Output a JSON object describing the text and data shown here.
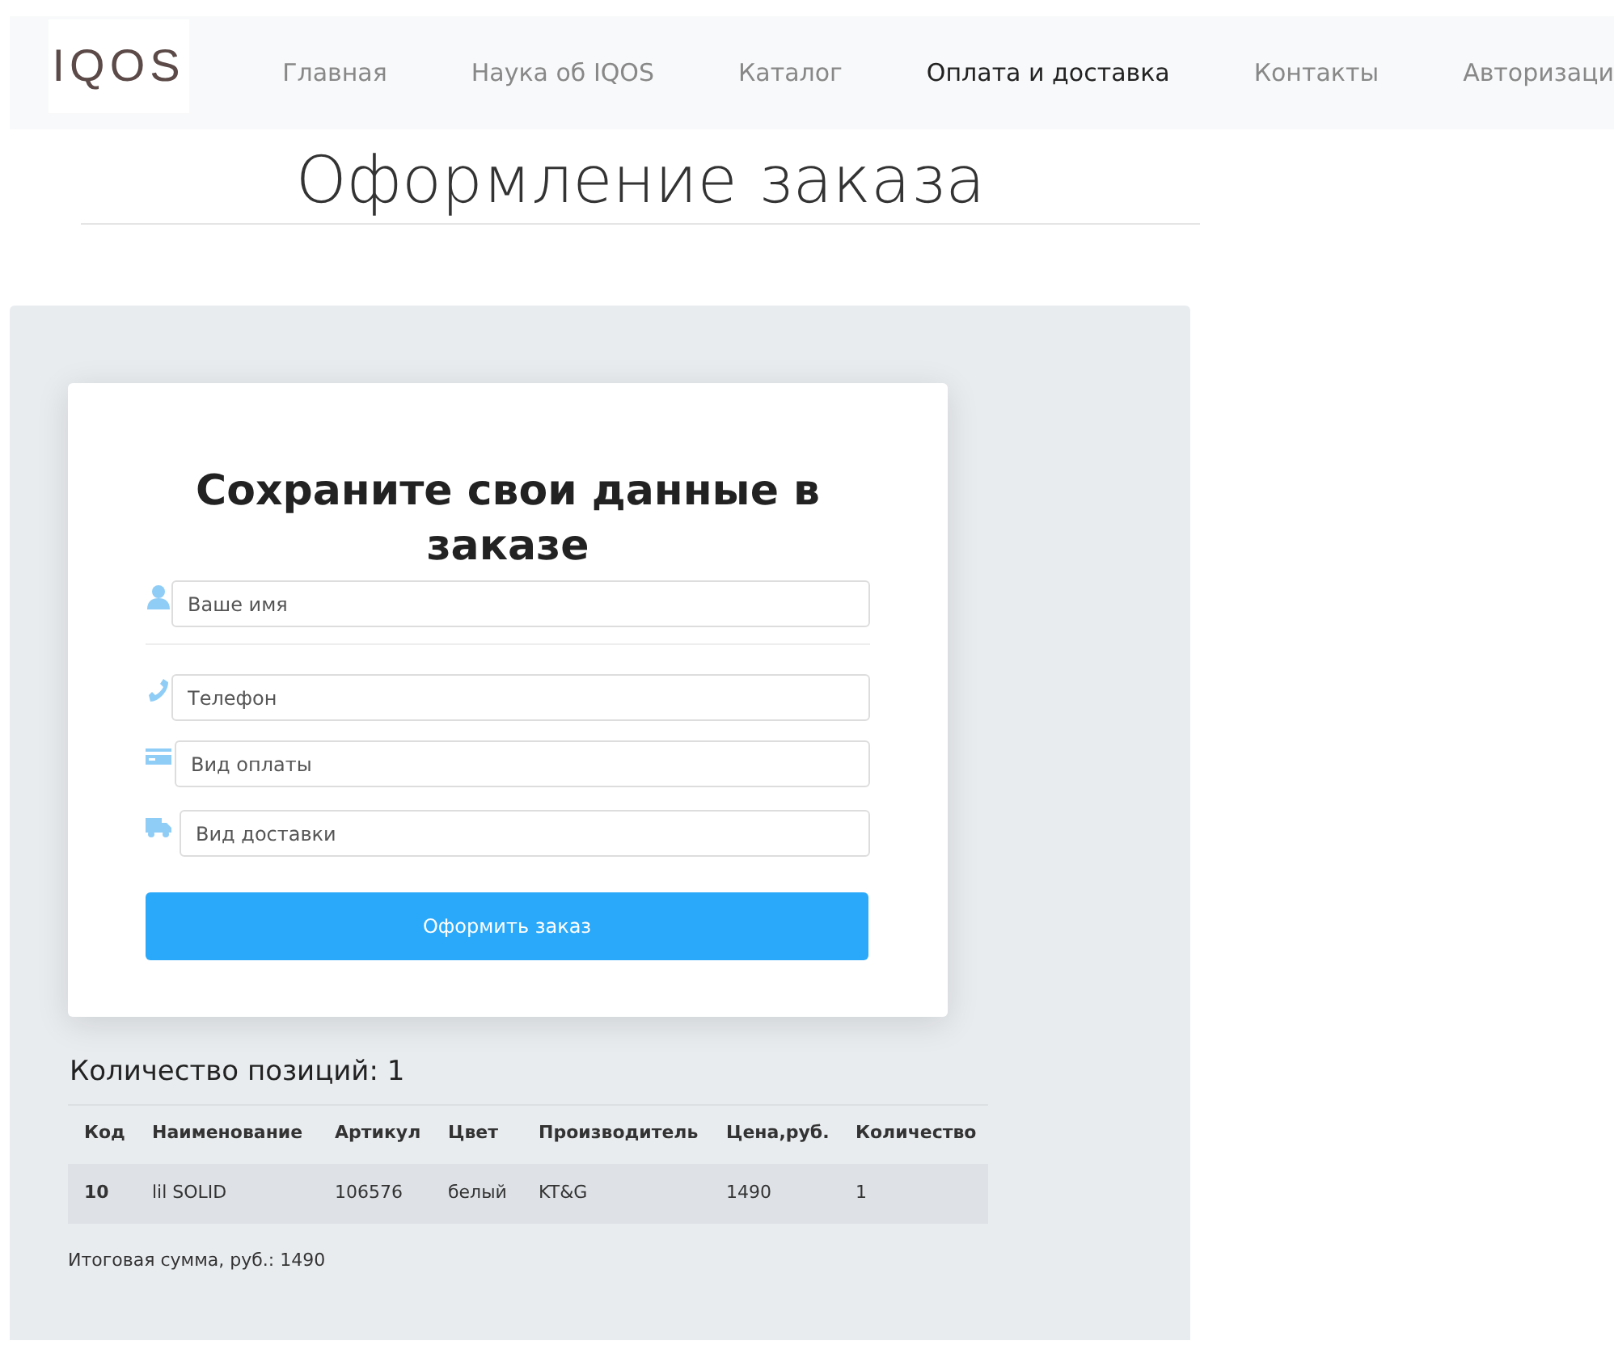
{
  "logo": {
    "text": "IQOS"
  },
  "nav": [
    {
      "label": "Главная",
      "selected": false
    },
    {
      "label": "Наука об IQOS",
      "selected": false
    },
    {
      "label": "Каталог",
      "selected": false
    },
    {
      "label": "Оплата и доставка",
      "selected": true
    },
    {
      "label": "Контакты",
      "selected": false
    },
    {
      "label": "Авторизаци",
      "selected": false
    }
  ],
  "page_title": "Оформление заказа",
  "form": {
    "title": "Сохраните свои данные в заказе",
    "fields": [
      {
        "kind": "person",
        "placeholder": "Ваше имя"
      },
      {
        "kind": "phone",
        "placeholder": "Телефон"
      },
      {
        "kind": "card",
        "placeholder": "Вид оплаты"
      },
      {
        "kind": "truck",
        "placeholder": "Вид доставки"
      }
    ],
    "submit": "Оформить заказ"
  },
  "cart": {
    "heading": "Количество позиций: 1",
    "table": {
      "columns": [
        "Код",
        "Наименование",
        "Артикул",
        "Цвет",
        "Производитель",
        "Цена,руб.",
        "Количество"
      ],
      "rows": [
        [
          "10",
          "lil SOLID",
          "106576",
          "белый",
          "KT&G",
          "1490",
          "1"
        ]
      ]
    },
    "total": "Итоговая сумма, руб.: 1490"
  }
}
